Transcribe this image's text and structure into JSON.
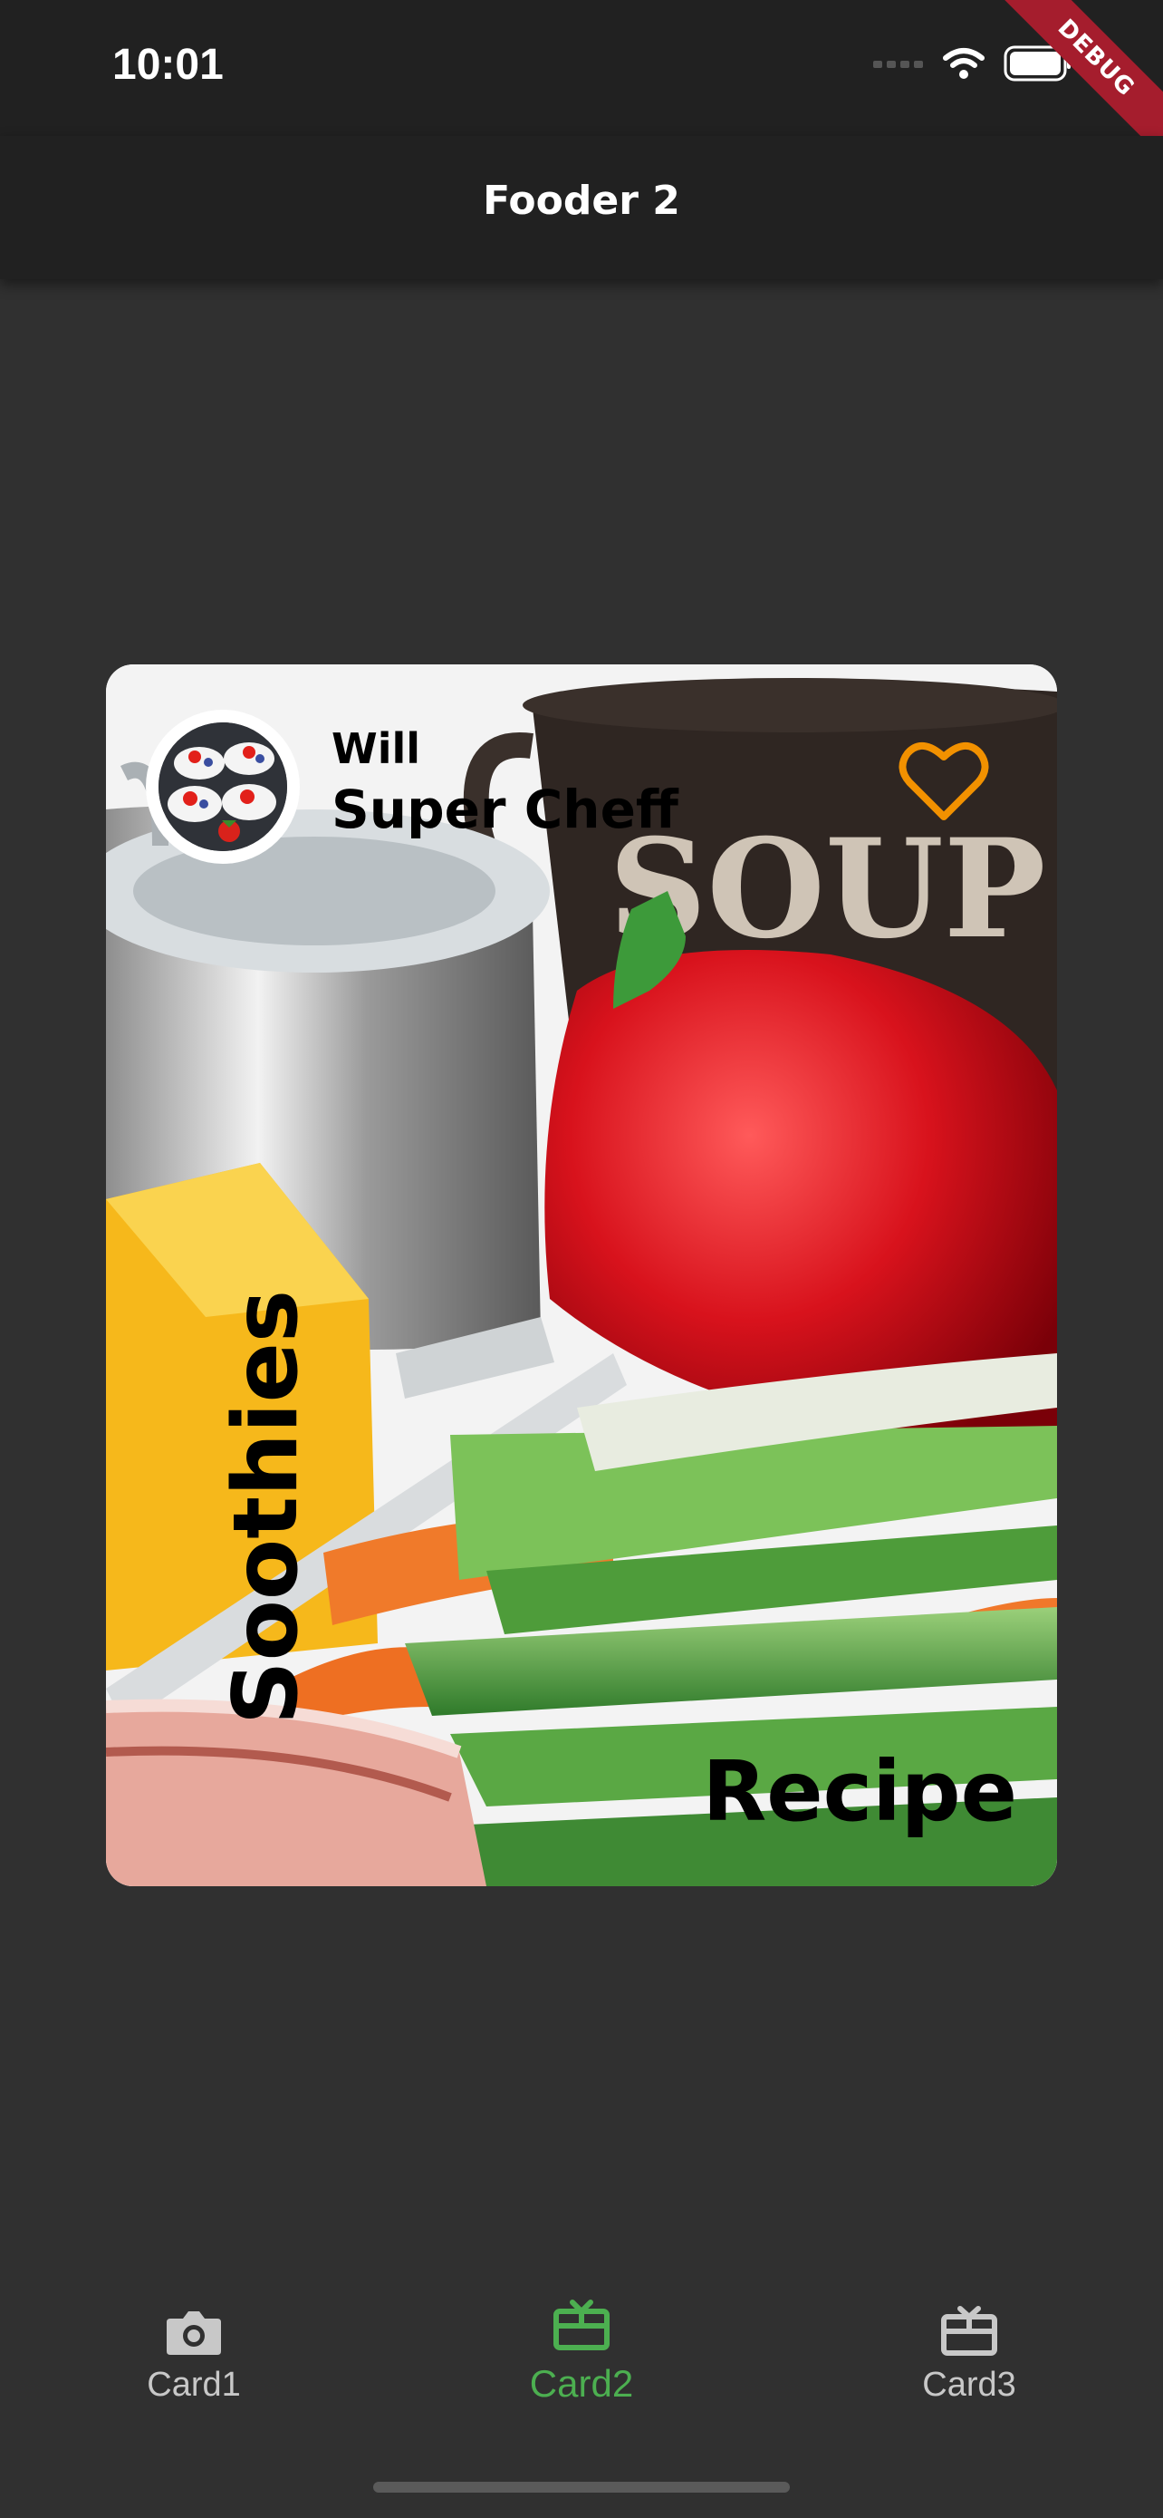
{
  "status_bar": {
    "time": "10:01"
  },
  "debug_banner": "DEBUG",
  "app_bar": {
    "title": "Fooder 2"
  },
  "card": {
    "author_name": "Will",
    "author_title": "Super Cheff",
    "vertical_label": "Soothies",
    "corner_label": "Recipe"
  },
  "bottom_nav": {
    "items": [
      {
        "label": "Card1",
        "icon": "camera-icon"
      },
      {
        "label": "Card2",
        "icon": "card-giftcard-icon",
        "active": true
      },
      {
        "label": "Card3",
        "icon": "card-giftcard-icon"
      }
    ],
    "active_color": "#4caf50",
    "inactive_color": "#c8c8c8"
  },
  "colors": {
    "background": "#303030",
    "bars": "#212121",
    "heart": "#f29100"
  }
}
